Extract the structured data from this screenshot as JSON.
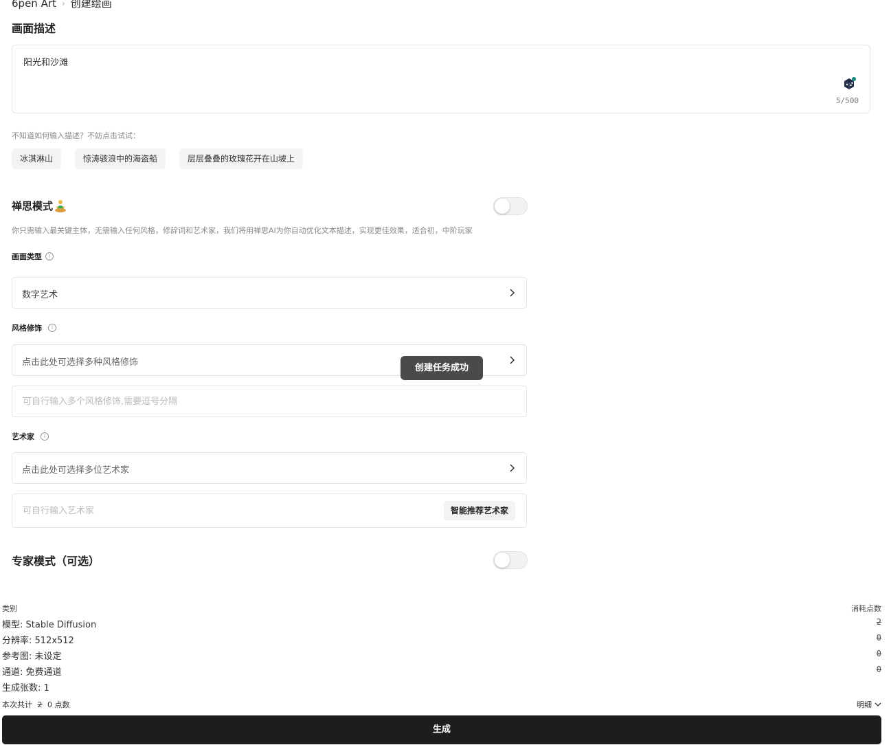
{
  "breadcrumb": {
    "root": "6pen Art",
    "separator": "›",
    "current": "创建绘画"
  },
  "description": {
    "title": "画面描述",
    "value": "阳光和沙滩",
    "counter": "5/500",
    "hint": "不知道如何输入描述？不妨点击试试：",
    "suggestions": [
      "冰淇淋山",
      "惊涛骇浪中的海盗船",
      "层层叠叠的玫瑰花开在山坡上"
    ]
  },
  "zen_mode": {
    "title": "禅思模式",
    "enabled": false,
    "description": "你只需输入最关键主体，无需输入任何风格，修辞词和艺术家，我们将用禅思AI为你自动优化文本描述，实现更佳效果，适合初，中阶玩家"
  },
  "picture_type": {
    "label": "画面类型",
    "value": "数字艺术"
  },
  "style": {
    "label": "风格修饰",
    "select_placeholder": "点击此处可选择多种风格修饰",
    "input_placeholder": "可自行输入多个风格修饰,需要逗号分隔"
  },
  "artist": {
    "label": "艺术家",
    "select_placeholder": "点击此处可选择多位艺术家",
    "input_placeholder": "可自行输入艺术家",
    "recommend_button": "智能推荐艺术家"
  },
  "toast": "创建任务成功",
  "expert_mode": {
    "title": "专家模式（可选）",
    "enabled": false
  },
  "cost": {
    "header_left": "类别",
    "header_right": "消耗点数",
    "rows": [
      {
        "label": "模型: Stable Diffusion",
        "points": "2"
      },
      {
        "label": "分辨率: 512x512",
        "points": "0"
      },
      {
        "label": "参考图: 未设定",
        "points": "0"
      },
      {
        "label": "通道: 免费通道",
        "points": "0"
      }
    ],
    "count": "生成张数: 1",
    "total_prefix": "本次共计",
    "total_struck": "2",
    "total_value": "0 点数",
    "detail_link": "明细"
  },
  "generate_button": "生成"
}
